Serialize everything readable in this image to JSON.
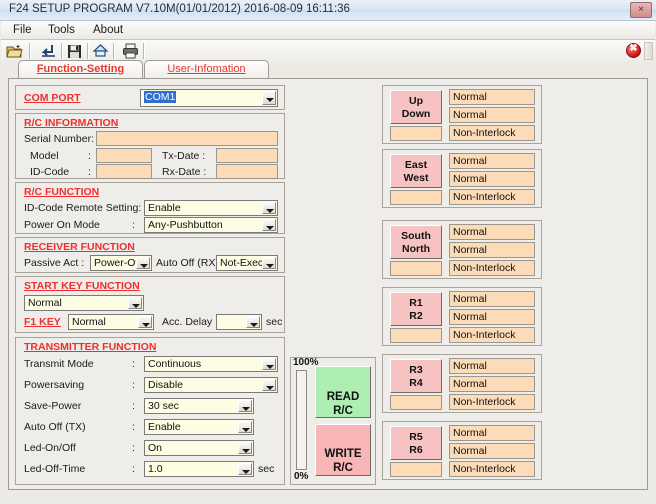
{
  "window": {
    "title": "F24 SETUP PROGRAM V7.10M(01/01/2012)  2016-08-09  16:11:36",
    "close_glyph": "×"
  },
  "menu": {
    "items": [
      {
        "label": "File"
      },
      {
        "label": "Tools"
      },
      {
        "label": "About"
      }
    ]
  },
  "toolbar": {
    "buttons": [
      {
        "name": "open-folder-icon",
        "glyph": "📂"
      },
      {
        "name": "download-icon",
        "glyph": "↵"
      },
      {
        "name": "save-icon",
        "glyph": "💾"
      },
      {
        "name": "upload-icon",
        "glyph": "⌂"
      },
      {
        "name": "print-icon",
        "glyph": "🖨"
      }
    ],
    "close_glyph": "✖"
  },
  "tabs": [
    {
      "label": "Function-Setting",
      "active": true
    },
    {
      "label": "User-Infomation",
      "active": false
    }
  ],
  "com_port": {
    "label": "COM  PORT",
    "value": "COM1"
  },
  "rc_information": {
    "title": "R/C INFORMATION",
    "serial_number_label": "Serial Number:",
    "serial_number_value": "",
    "model_label": "Model",
    "model_colon": ":",
    "model_value": "",
    "id_code_label": "ID-Code",
    "id_code_colon": ":",
    "id_code_value": "",
    "tx_date_label": "Tx-Date :",
    "tx_date_value": "",
    "rx_date_label": "Rx-Date :",
    "rx_date_value": ""
  },
  "rc_function": {
    "title": "R/C  FUNCTION",
    "id_code_remote_label": "ID-Code Remote Setting:",
    "id_code_remote_value": "Enable",
    "power_on_mode_label": "Power On Mode",
    "power_on_mode_colon": ":",
    "power_on_mode_value": "Any-Pushbutton"
  },
  "receiver_function": {
    "title": "RECEIVER  FUNCTION",
    "passive_act_label": "Passive Act  :",
    "passive_act_value": "Power-Off",
    "auto_off_rx_label": "Auto Off (RX):",
    "auto_off_rx_value": "Not-Execut"
  },
  "start_key_function": {
    "title": "START KEY FUNCTION",
    "start_key_value": "Normal",
    "f1_key_label": "F1 KEY",
    "f1_key_value": "Normal",
    "acc_delay_label": "Acc. Delay",
    "acc_delay_value": "",
    "acc_delay_unit": "sec"
  },
  "transmitter_function": {
    "title": "TRANSMITTER FUNCTION",
    "rows": [
      {
        "label": "Transmit Mode",
        "colon": ":",
        "value": "Continuous",
        "unit": ""
      },
      {
        "label": "Powersaving",
        "colon": ":",
        "value": "Disable",
        "unit": ""
      },
      {
        "label": "Save-Power",
        "colon": ":",
        "value": "30 sec",
        "unit": ""
      },
      {
        "label": "Auto Off (TX)",
        "colon": ":",
        "value": "Enable",
        "unit": ""
      },
      {
        "label": "Led-On/Off",
        "colon": ":",
        "value": "On",
        "unit": ""
      },
      {
        "label": "Led-Off-Time",
        "colon": ":",
        "value": "1.0",
        "unit": "sec"
      }
    ]
  },
  "progress": {
    "top_label": "100%",
    "bottom_label": "0%",
    "value": 0
  },
  "actions": {
    "read": {
      "line1": "READ",
      "line2": "R/C",
      "color": "#aeeeb2"
    },
    "write": {
      "line1": "WRITE",
      "line2": "R/C",
      "color": "#f8b6b6"
    }
  },
  "direction_panels": [
    {
      "btn_line1": "Up",
      "btn_line2": "Down",
      "field": "",
      "values": [
        "Normal",
        "Normal",
        "Non-Interlock"
      ]
    },
    {
      "btn_line1": "East",
      "btn_line2": "West",
      "field": "",
      "values": [
        "Normal",
        "Normal",
        "Non-Interlock"
      ]
    },
    {
      "btn_line1": "South",
      "btn_line2": "North",
      "field": "",
      "values": [
        "Normal",
        "Normal",
        "Non-Interlock"
      ]
    },
    {
      "btn_line1": "R1",
      "btn_line2": "R2",
      "field": "",
      "values": [
        "Normal",
        "Normal",
        "Non-Interlock"
      ]
    },
    {
      "btn_line1": "R3",
      "btn_line2": "R4",
      "field": "",
      "values": [
        "Normal",
        "Normal",
        "Non-Interlock"
      ]
    },
    {
      "btn_line1": "R5",
      "btn_line2": "R6",
      "field": "",
      "values": [
        "Normal",
        "Normal",
        "Non-Interlock"
      ]
    }
  ]
}
